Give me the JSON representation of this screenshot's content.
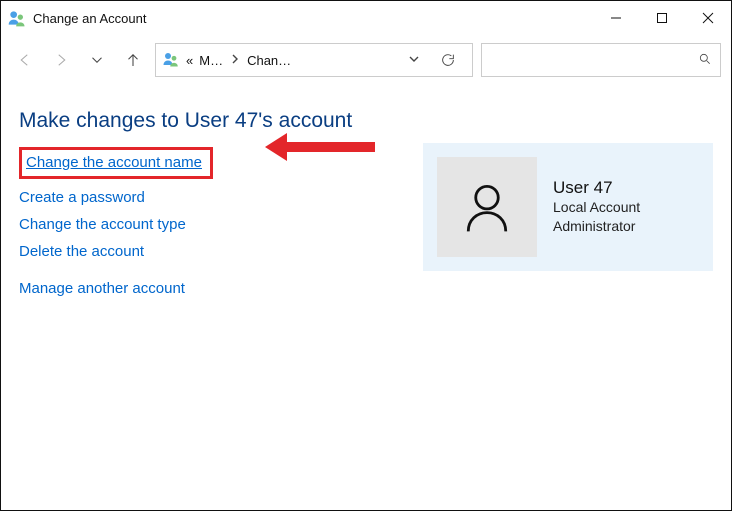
{
  "window": {
    "title": "Change an Account"
  },
  "breadcrumb": {
    "seg1": "M…",
    "seg2": "Chan…"
  },
  "search": {
    "placeholder": ""
  },
  "heading": "Make changes to User 47's account",
  "links": {
    "change_name": "Change the account name",
    "create_password": "Create a password",
    "change_type": "Change the account type",
    "delete": "Delete the account",
    "manage_other": "Manage another account"
  },
  "user": {
    "name": "User 47",
    "type": "Local Account",
    "role": "Administrator"
  }
}
